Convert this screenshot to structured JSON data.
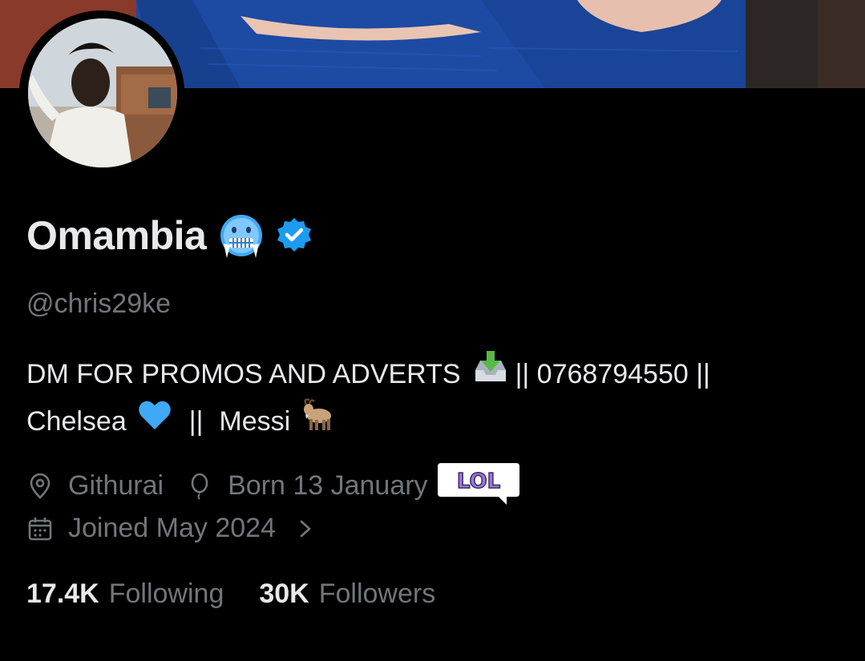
{
  "profile": {
    "display_name": "Omambia",
    "handle": "@chris29ke",
    "bio": {
      "line1_text": "DM FOR PROMOS AND ADVERTS",
      "line1_phone": "|| 0768794550  ||",
      "line2_club": "Chelsea",
      "line2_sep": "||",
      "line2_player": "Messi"
    },
    "location": "Githurai",
    "birthday": "Born 13 January",
    "joined": "Joined May 2024",
    "sticker_text": "LOL"
  },
  "stats": {
    "following_count": "17.4K",
    "following_label": "Following",
    "followers_count": "30K",
    "followers_label": "Followers"
  },
  "icons": {
    "verified": "verified-badge-icon",
    "cold_face": "cold-face-emoji",
    "inbox_tray": "inbox-tray-emoji",
    "blue_heart": "blue-heart-emoji",
    "goat": "goat-emoji",
    "location": "location-pin-icon",
    "birthday": "balloon-icon",
    "joined": "calendar-icon",
    "chevron": "chevron-right-icon"
  },
  "colors": {
    "background": "#000000",
    "primary_text": "#e7e9ea",
    "secondary_text": "#71767b",
    "verified_blue": "#1d9bf0"
  }
}
